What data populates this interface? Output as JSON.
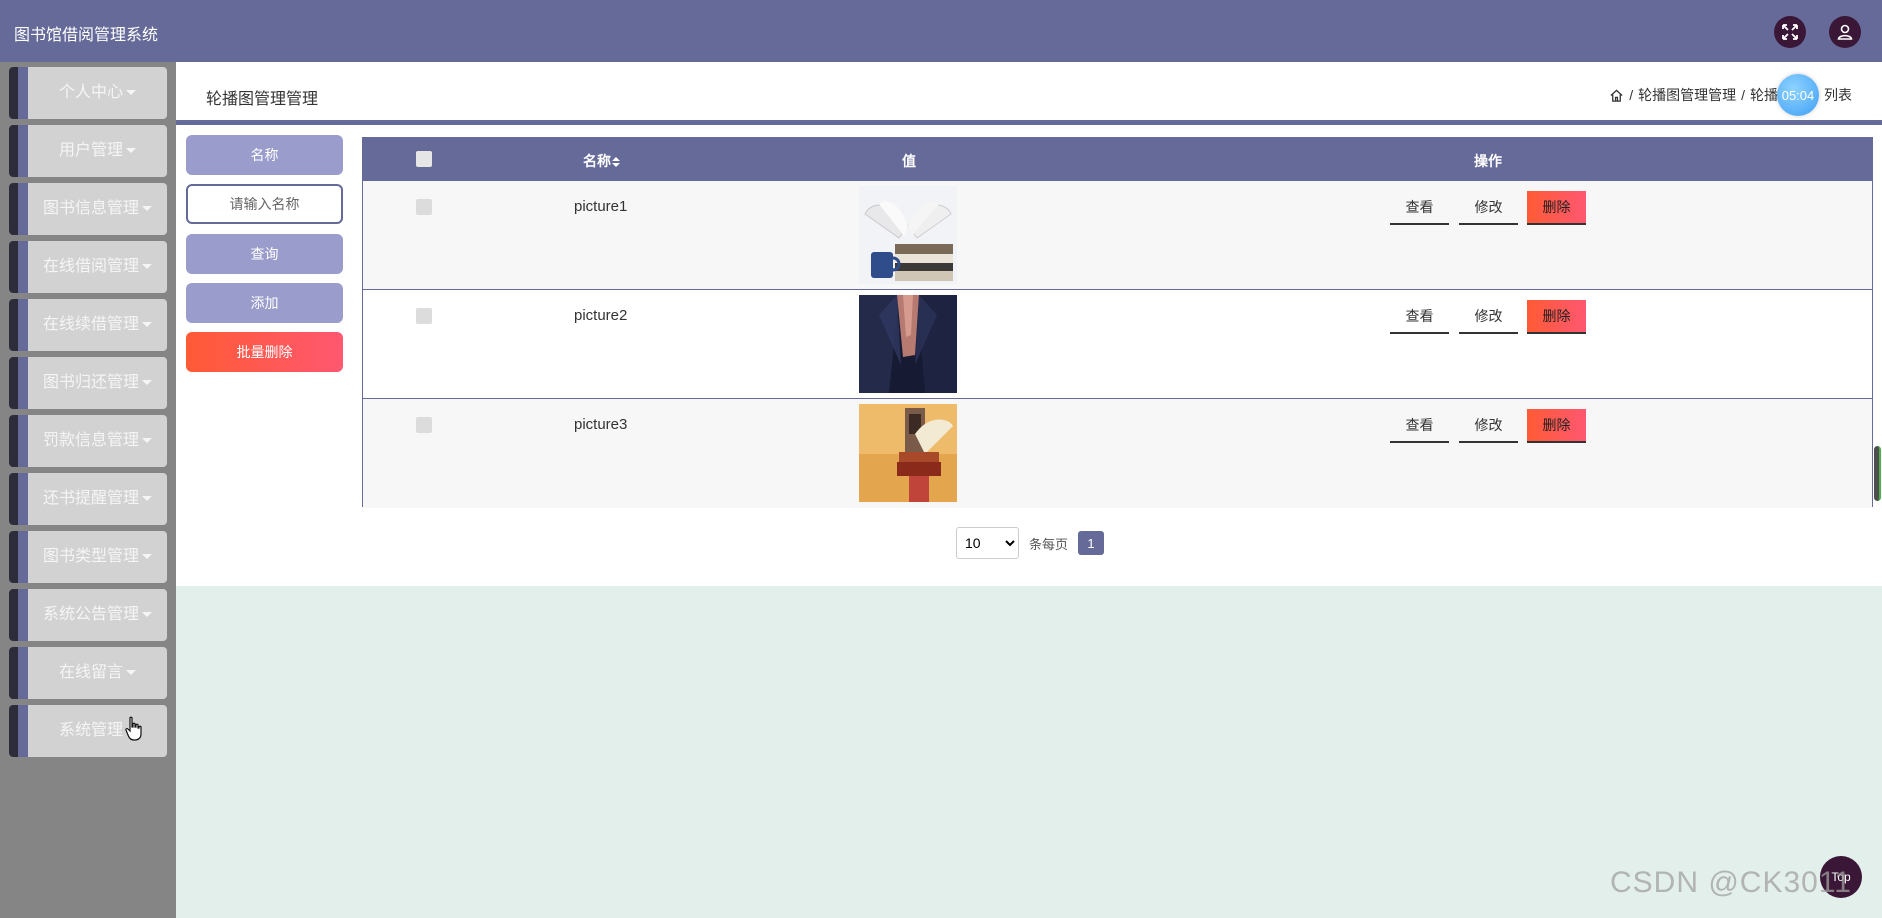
{
  "app": {
    "title": "图书馆借阅管理系统"
  },
  "topbar": {
    "fullscreen_icon": "expand-icon",
    "user_icon": "user-icon"
  },
  "sidebar": {
    "items": [
      {
        "label": "个人中心"
      },
      {
        "label": "用户管理"
      },
      {
        "label": "图书信息管理"
      },
      {
        "label": "在线借阅管理"
      },
      {
        "label": "在线续借管理"
      },
      {
        "label": "图书归还管理"
      },
      {
        "label": "罚款信息管理"
      },
      {
        "label": "还书提醒管理"
      },
      {
        "label": "图书类型管理"
      },
      {
        "label": "系统公告管理"
      },
      {
        "label": "在线留言"
      },
      {
        "label": "系统管理"
      }
    ]
  },
  "header": {
    "page_title": "轮播图管理管理",
    "breadcrumb": {
      "level1": "轮播图管理管理",
      "level2_prefix": "轮播",
      "level2_suffix": "列表",
      "sep": "/"
    },
    "timer": "05:04"
  },
  "search": {
    "field_label": "名称",
    "placeholder": "请输入名称",
    "query_button": "查询",
    "add_button": "添加",
    "batch_delete_button": "批量删除"
  },
  "table": {
    "columns": {
      "name": "名称",
      "value": "值",
      "actions": "操作"
    },
    "rows": [
      {
        "name": "picture1",
        "view": "查看",
        "edit": "修改",
        "delete": "删除"
      },
      {
        "name": "picture2",
        "view": "查看",
        "edit": "修改",
        "delete": "删除"
      },
      {
        "name": "picture3",
        "view": "查看",
        "edit": "修改",
        "delete": "删除"
      }
    ]
  },
  "pagination": {
    "page_size": "10",
    "per_page_label": "条每页",
    "current_page": "1"
  },
  "floating": {
    "top_button": "Top"
  },
  "watermark": "CSDN @CK3011",
  "colors": {
    "primary": "#656a99",
    "danger": "#ff5a36",
    "sidebar_bg": "#858585",
    "page_bg": "#e3efea"
  }
}
